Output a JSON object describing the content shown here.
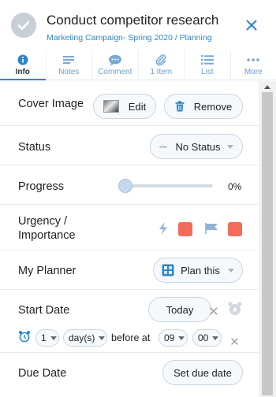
{
  "header": {
    "title": "Conduct competitor research",
    "breadcrumb": "Marketing Campaign- Spring 2020 / Planning"
  },
  "tabs": [
    {
      "label": "Info",
      "icon": "info-icon",
      "active": true
    },
    {
      "label": "Notes",
      "icon": "notes-icon"
    },
    {
      "label": "Comment",
      "icon": "comment-icon"
    },
    {
      "label": "1 Item",
      "icon": "paperclip-icon"
    },
    {
      "label": "List",
      "icon": "list-icon"
    },
    {
      "label": "More",
      "icon": "more-icon"
    }
  ],
  "fields": {
    "cover_image": {
      "label": "Cover Image",
      "edit_label": "Edit",
      "remove_label": "Remove"
    },
    "status": {
      "label": "Status",
      "value": "No Status"
    },
    "progress": {
      "label": "Progress",
      "value_text": "0%",
      "value": 0
    },
    "urgency": {
      "label_line1": "Urgency /",
      "label_line2": "Importance"
    },
    "planner": {
      "label": "My Planner",
      "button_label": "Plan this"
    },
    "start_date": {
      "label": "Start Date",
      "today_label": "Today",
      "reminder_count": "1",
      "reminder_unit": "day(s)",
      "before_at_text": "before at",
      "hour": "09",
      "minute": "00"
    },
    "due_date": {
      "label": "Due Date",
      "button_label": "Set due date"
    }
  },
  "colors": {
    "accent": "#2e86c8",
    "urgency_red": "#f26b5b",
    "border": "#c9d5e0"
  }
}
